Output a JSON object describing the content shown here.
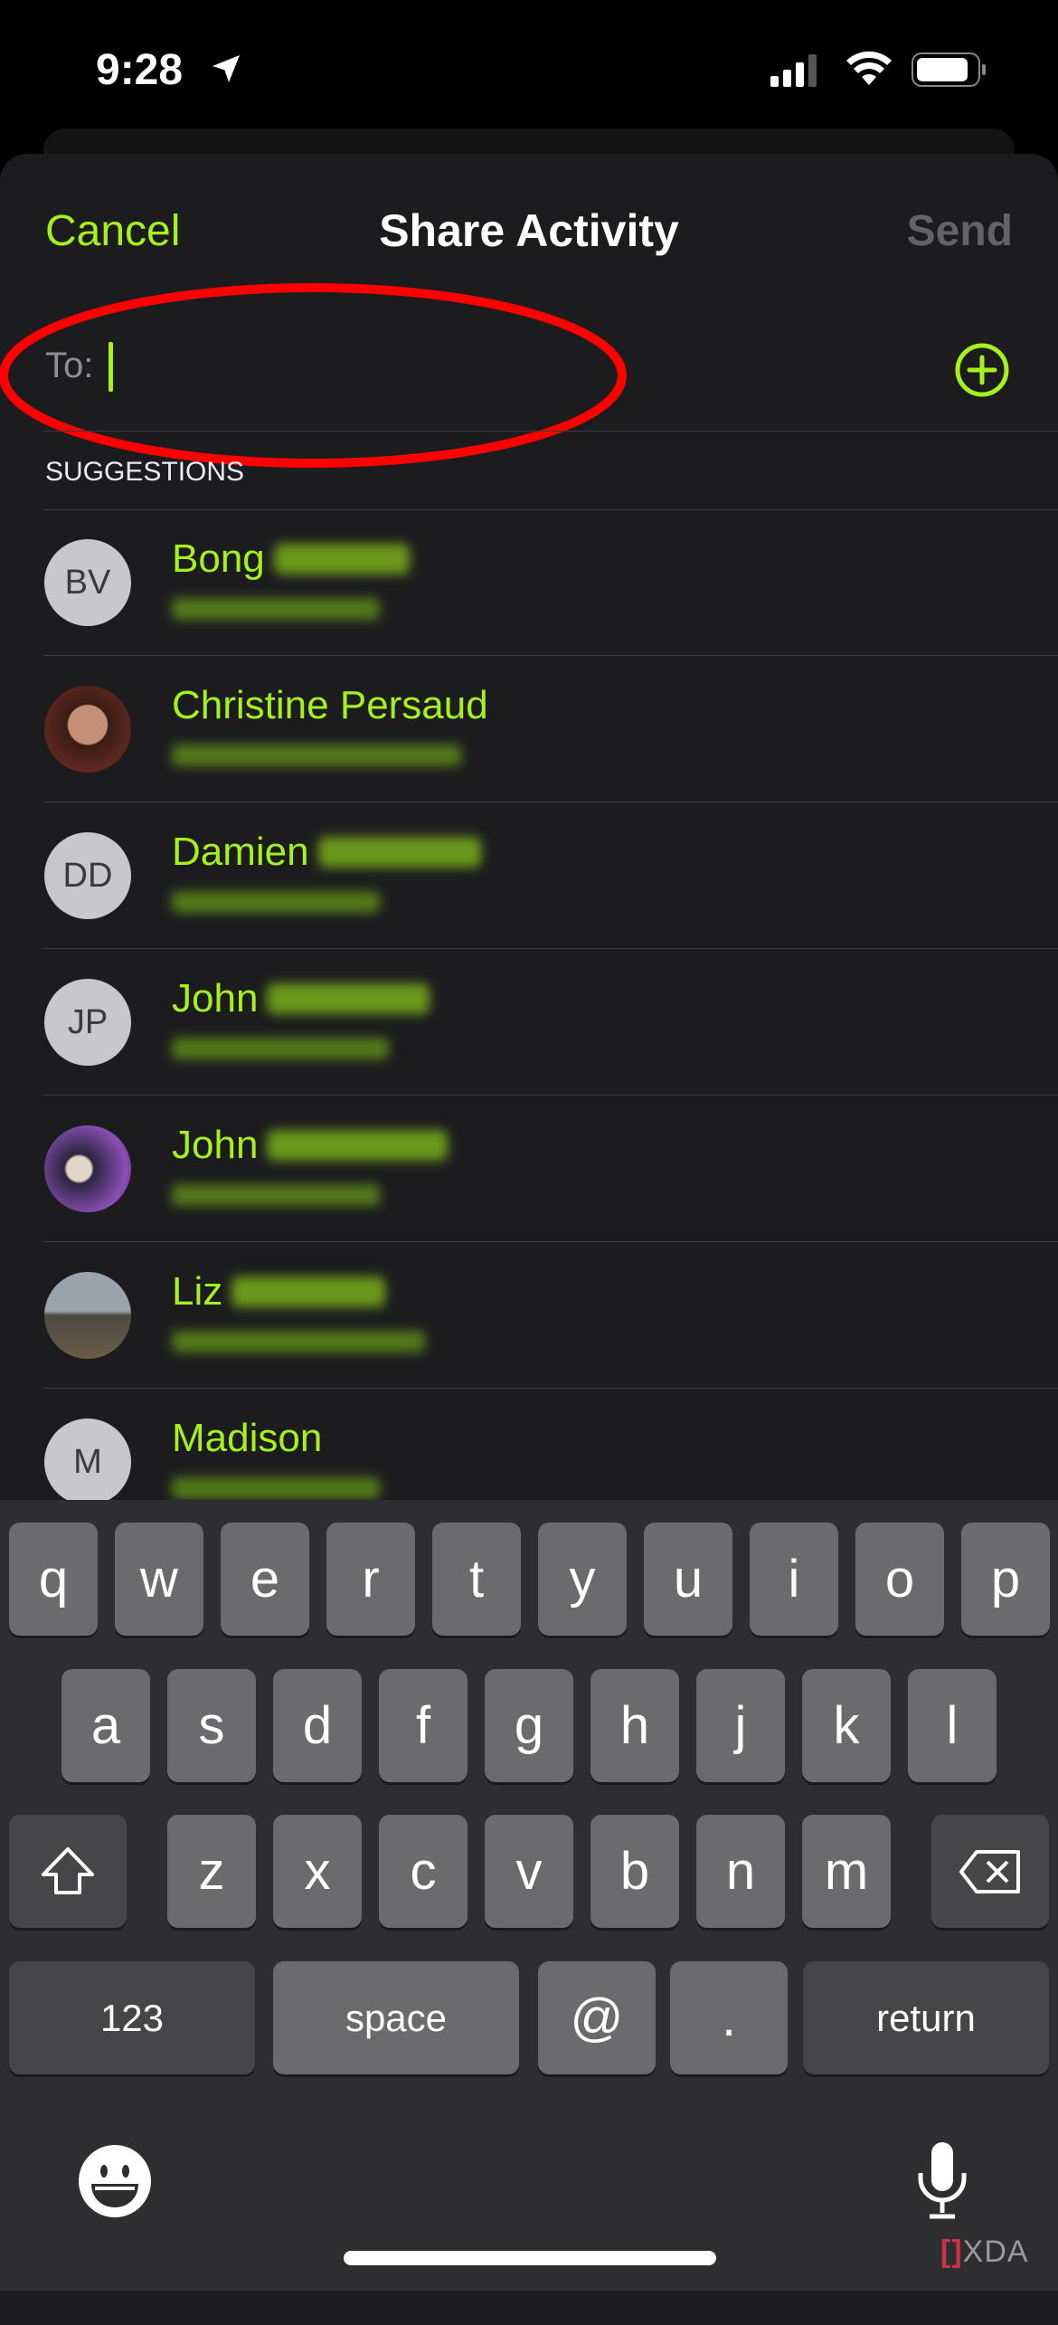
{
  "status_bar": {
    "time": "9:28",
    "icons": [
      "location-arrow-icon",
      "cellular-signal-icon",
      "wifi-icon",
      "battery-icon"
    ]
  },
  "nav": {
    "cancel": "Cancel",
    "title": "Share Activity",
    "send": "Send"
  },
  "to_field": {
    "label": "To:",
    "value": "",
    "add_icon": "plus-circle-icon"
  },
  "suggestions": {
    "header": "SUGGESTIONS",
    "items": [
      {
        "initials": "BV",
        "name": "Bong",
        "photo": false
      },
      {
        "initials": "",
        "name": "Christine Persaud",
        "photo": true
      },
      {
        "initials": "DD",
        "name": "Damien",
        "photo": false
      },
      {
        "initials": "JP",
        "name": "John",
        "photo": false
      },
      {
        "initials": "",
        "name": "John",
        "photo": true
      },
      {
        "initials": "",
        "name": "Liz",
        "photo": true
      },
      {
        "initials": "M",
        "name": "Madison",
        "photo": false
      }
    ]
  },
  "keyboard": {
    "row1": [
      "q",
      "w",
      "e",
      "r",
      "t",
      "y",
      "u",
      "i",
      "o",
      "p"
    ],
    "row2": [
      "a",
      "s",
      "d",
      "f",
      "g",
      "h",
      "j",
      "k",
      "l"
    ],
    "row3": [
      "z",
      "x",
      "c",
      "v",
      "b",
      "n",
      "m"
    ],
    "numbers": "123",
    "space": "space",
    "at": "@",
    "dot": ".",
    "return": "return"
  },
  "watermark": "XDA",
  "colors": {
    "accent": "#a6f11c",
    "annotation": "#ff0000",
    "background": "#1c1c1e"
  }
}
